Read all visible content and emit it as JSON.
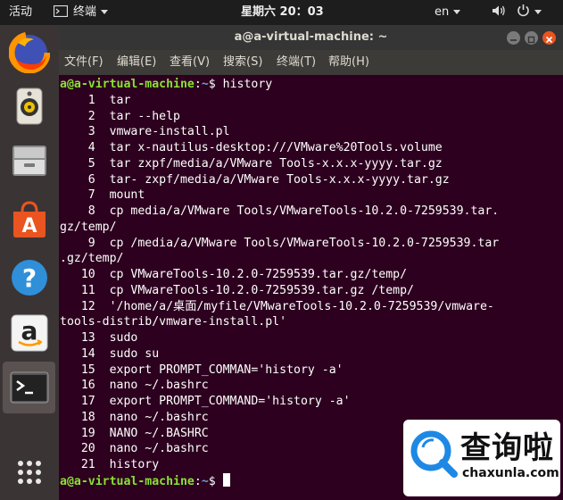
{
  "topbar": {
    "activities": "活动",
    "app_menu": "终端",
    "clock": "星期六 20：03",
    "lang": "en"
  },
  "dock": {
    "items": [
      "firefox-icon",
      "speaker-icon",
      "files-icon",
      "software-icon",
      "help-icon",
      "amazon-icon",
      "terminal-icon",
      "apps-grid-icon"
    ]
  },
  "window": {
    "title": "a@a-virtual-machine: ~",
    "menus": [
      "文件(F)",
      "编辑(E)",
      "查看(V)",
      "搜索(S)",
      "终端(T)",
      "帮助(H)"
    ]
  },
  "terminal": {
    "prompt_user": "a@a-virtual-machine",
    "prompt_sep": ":",
    "prompt_path": "~",
    "prompt_sign": "$ ",
    "command": "history",
    "history_lines": [
      "    1  tar",
      "    2  tar --help",
      "    3  vmware-install.pl",
      "    4  tar x-nautilus-desktop:///VMware%20Tools.volume",
      "    5  tar zxpf/media/a/VMware Tools-x.x.x-yyyy.tar.gz",
      "    6  tar- zxpf/media/a/VMware Tools-x.x.x-yyyy.tar.gz",
      "    7  mount",
      "    8  cp media/a/VMware Tools/VMwareTools-10.2.0-7259539.tar.",
      "gz/temp/",
      "    9  cp /media/a/VMware Tools/VMwareTools-10.2.0-7259539.tar",
      ".gz/temp/",
      "   10  cp VMwareTools-10.2.0-7259539.tar.gz/temp/",
      "   11  cp VMwareTools-10.2.0-7259539.tar.gz /temp/",
      "   12  '/home/a/桌面/myfile/VMwareTools-10.2.0-7259539/vmware-",
      "tools-distrib/vmware-install.pl'",
      "   13  sudo",
      "   14  sudo su",
      "   15  export PROMPT_COMMAN='history -a'",
      "   16  nano ~/.bashrc",
      "   17  export PROMPT_COMMAND='history -a'",
      "   18  nano ~/.bashrc",
      "   19  NANO ~/.BASHRC",
      "   20  nano ~/.bashrc",
      "   21  history"
    ]
  },
  "watermark": {
    "text": "查询啦",
    "url": "chaxunla.com"
  },
  "colors": {
    "terminal_bg": "#2c001e",
    "prompt_user": "#8ae234",
    "prompt_path": "#729fcf",
    "accent": "#e95420"
  }
}
